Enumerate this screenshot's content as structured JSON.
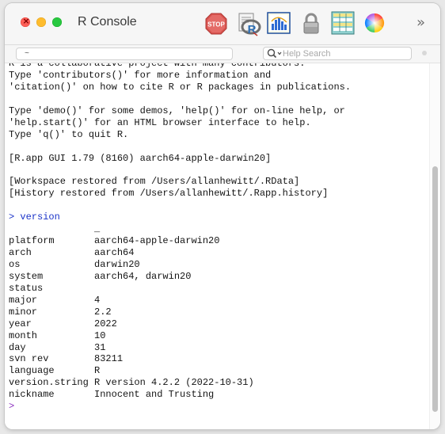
{
  "window": {
    "title": "R Console"
  },
  "toolbar": {
    "icons": [
      "stop-icon",
      "r-source-icon",
      "quartz-chart-icon",
      "lock-icon",
      "data-editor-table-icon",
      "color-wheel-icon"
    ],
    "more_label": "»",
    "stop_label": "STOP",
    "r_label": "R"
  },
  "pathbar": {
    "path_value": "~",
    "search_placeholder": "Help Search"
  },
  "console": {
    "lines": [
      {
        "text": "R is a collaborative project with many contributors.",
        "kind": "output"
      },
      {
        "text": "Type 'contributors()' for more information and",
        "kind": "output"
      },
      {
        "text": "'citation()' on how to cite R or R packages in publications.",
        "kind": "output"
      },
      {
        "text": "",
        "kind": "output"
      },
      {
        "text": "Type 'demo()' for some demos, 'help()' for on-line help, or",
        "kind": "output"
      },
      {
        "text": "'help.start()' for an HTML browser interface to help.",
        "kind": "output"
      },
      {
        "text": "Type 'q()' to quit R.",
        "kind": "output"
      },
      {
        "text": "",
        "kind": "output"
      },
      {
        "text": "[R.app GUI 1.79 (8160) aarch64-apple-darwin20]",
        "kind": "output"
      },
      {
        "text": "",
        "kind": "output"
      },
      {
        "text": "[Workspace restored from /Users/allanhewitt/.RData]",
        "kind": "output"
      },
      {
        "text": "[History restored from /Users/allanhewitt/.Rapp.history]",
        "kind": "output"
      },
      {
        "text": "",
        "kind": "output"
      },
      {
        "text": "> version",
        "kind": "input"
      },
      {
        "text": "               _",
        "kind": "output"
      },
      {
        "text": "platform       aarch64-apple-darwin20",
        "kind": "output"
      },
      {
        "text": "arch           aarch64",
        "kind": "output"
      },
      {
        "text": "os             darwin20",
        "kind": "output"
      },
      {
        "text": "system         aarch64, darwin20",
        "kind": "output"
      },
      {
        "text": "status",
        "kind": "output"
      },
      {
        "text": "major          4",
        "kind": "output"
      },
      {
        "text": "minor          2.2",
        "kind": "output"
      },
      {
        "text": "year           2022",
        "kind": "output"
      },
      {
        "text": "month          10",
        "kind": "output"
      },
      {
        "text": "day            31",
        "kind": "output"
      },
      {
        "text": "svn rev        83211",
        "kind": "output"
      },
      {
        "text": "language       R",
        "kind": "output"
      },
      {
        "text": "version.string R version 4.2.2 (2022-10-31)",
        "kind": "output"
      },
      {
        "text": "nickname       Innocent and Trusting",
        "kind": "output"
      },
      {
        "text": ">",
        "kind": "prompt"
      }
    ]
  },
  "colors": {
    "input_text": "#1a33c8",
    "prompt": "#8a2fbe",
    "output_text": "#141414"
  }
}
